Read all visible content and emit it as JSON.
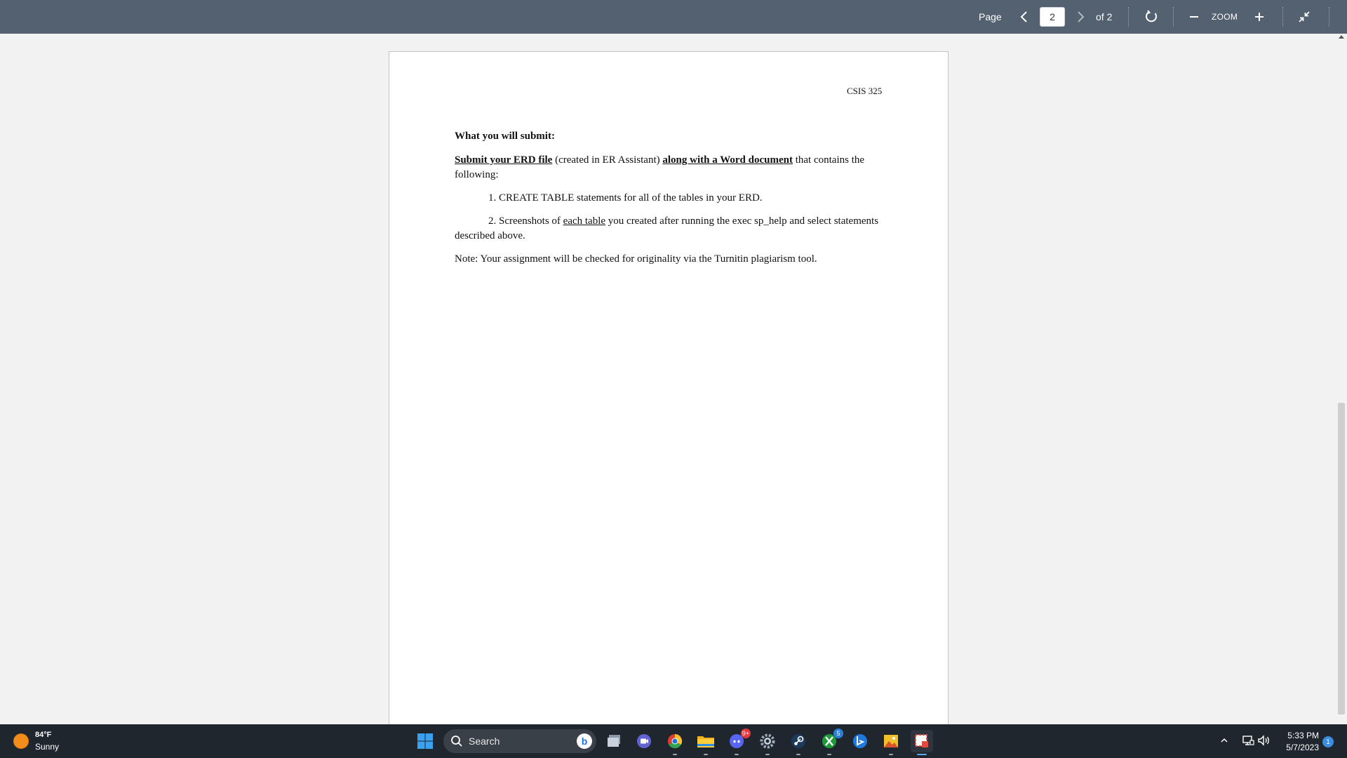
{
  "toolbar": {
    "page_label": "Page",
    "current_page": "2",
    "of_label": "of 2",
    "zoom_label": "ZOOM",
    "background_color": "#536170"
  },
  "document": {
    "course_code": "CSIS 325",
    "heading": "What you will submit:",
    "p1_bold1": "Submit your ERD file",
    "p1_text1": " (created in ER Assistant) ",
    "p1_bold2": "along with a Word document",
    "p1_text2": " that contains the following:",
    "item1": "1. CREATE TABLE statements for all of the tables in your ERD.",
    "item2_prefix": "2. Screenshots of ",
    "item2_underline": "each table",
    "item2_suffix": " you created after running the exec sp_help and select statements described above.",
    "note": "Note: Your assignment will be checked for originality via the Turnitin plagiarism tool."
  },
  "taskbar": {
    "weather_temp": "84°F",
    "weather_condition": "Sunny",
    "search_placeholder": "Search",
    "discord_badge": "9+",
    "xbox_badge": "5",
    "clock_time": "5:33 PM",
    "clock_date": "5/7/2023",
    "notification_count": "1",
    "icons": [
      "start-icon",
      "search-icon",
      "task-view-icon",
      "teams-chat-icon",
      "chrome-icon",
      "file-explorer-icon",
      "discord-icon",
      "settings-icon",
      "steam-icon",
      "xbox-icon",
      "edge-bing-icon",
      "photos-icon",
      "snipping-tool-icon"
    ]
  },
  "colors": {
    "toolbar": "#536170",
    "taskbar": "#20262e",
    "page_bg": "#f2f2f2"
  }
}
